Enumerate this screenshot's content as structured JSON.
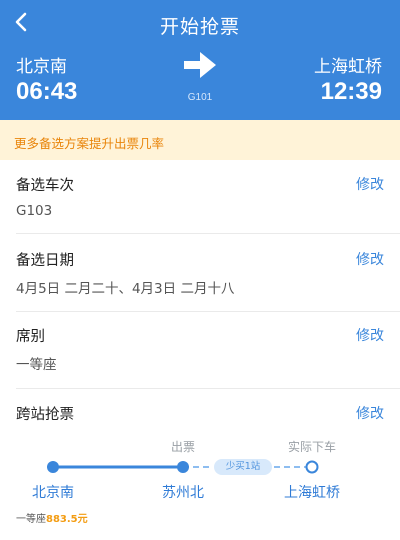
{
  "header": {
    "title": "开始抢票",
    "from_station": "北京南",
    "from_time": "06:43",
    "to_station": "上海虹桥",
    "to_time": "12:39",
    "train_no": "G101"
  },
  "tip": "更多备选方案提升出票几率",
  "rows": [
    {
      "label": "备选车次",
      "value": "G103",
      "action": "修改"
    },
    {
      "label": "备选日期",
      "value": "4月5日 二月二十、4月3日 二月十八",
      "action": "修改"
    },
    {
      "label": "席别",
      "value": "一等座",
      "action": "修改"
    },
    {
      "label": "跨站抢票",
      "value": "",
      "action": "修改"
    }
  ],
  "route": {
    "ticket_label": "出票",
    "actual_label": "实际下车",
    "badge": "少买1站",
    "stations": [
      "北京南",
      "苏州北",
      "上海虹桥"
    ]
  },
  "price": {
    "seat": "一等座",
    "amount": "883.5元"
  },
  "colors": {
    "primary": "#3a86db",
    "tip_bg": "#fff3d8",
    "tip_text": "#e9850b",
    "price": "#f39c12"
  }
}
